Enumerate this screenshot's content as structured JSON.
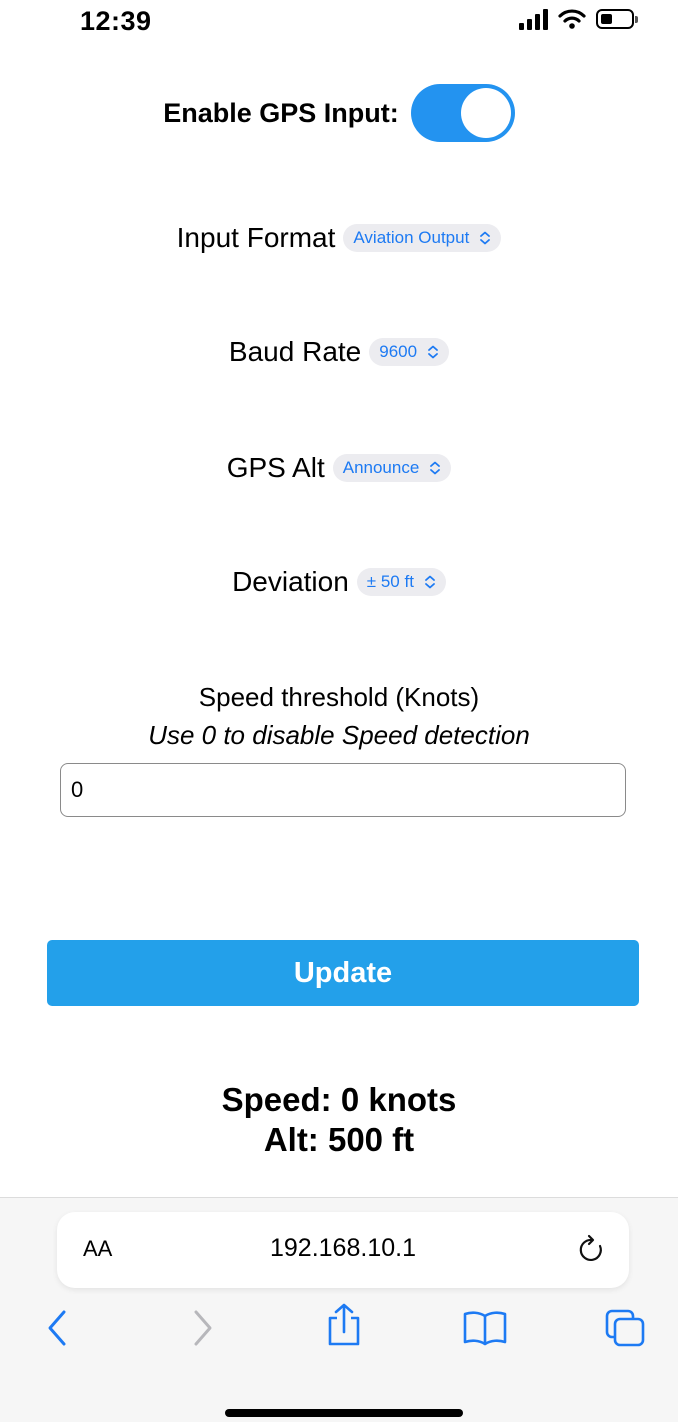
{
  "status_bar": {
    "time": "12:39"
  },
  "form": {
    "gps_label": "Enable GPS Input:",
    "gps_enabled": true,
    "input_format": {
      "label": "Input Format",
      "value": "Aviation Output"
    },
    "baud_rate": {
      "label": "Baud Rate",
      "value": "9600"
    },
    "gps_alt": {
      "label": "GPS Alt",
      "value": "Announce"
    },
    "deviation": {
      "label": "Deviation",
      "value": "± 50 ft"
    },
    "speed_threshold": {
      "label": "Speed threshold (Knots)",
      "hint": "Use 0 to disable Speed detection",
      "value": "0"
    },
    "update_label": "Update"
  },
  "readout": {
    "speed": "Speed: 0 knots",
    "alt": "Alt: 500 ft"
  },
  "browser": {
    "aa_label": "AA",
    "url": "192.168.10.1"
  },
  "colors": {
    "accent": "#2393f0",
    "button": "#23a0ea",
    "link": "#1d7af3"
  }
}
